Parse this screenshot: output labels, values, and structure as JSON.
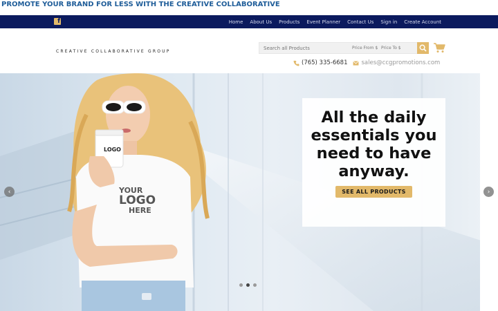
{
  "promo": {
    "text": "PROMOTE YOUR BRAND FOR LESS WITH THE CREATIVE COLLABORATIVE"
  },
  "topnav": {
    "facebook_icon": "facebook-icon",
    "links": [
      "Home",
      "About Us",
      "Products",
      "Event Planner",
      "Contact Us",
      "Sign in",
      "Create Account"
    ]
  },
  "header": {
    "brand": "CREATIVE COLLABORATIVE GROUP",
    "search": {
      "placeholder": "Search all Products",
      "price_from_placeholder": "Price From $",
      "price_to_placeholder": "Price To $"
    },
    "search_icon": "search-icon",
    "cart_icon": "cart-icon",
    "phone": "(765) 335-6681",
    "email": "sales@ccgpromotions.com"
  },
  "hero": {
    "heading": "All the daily essentials you need to have anyway.",
    "cta": "SEE ALL PRODUCTS",
    "cup_logo": "LOGO",
    "shirt_logo_line1": "YOUR",
    "shirt_logo_line2": "LOGO",
    "shirt_logo_line3": "HERE",
    "slides": 3,
    "active_slide": 2
  },
  "colors": {
    "navy": "#0b1a5e",
    "gold": "#e2b96a",
    "promo_blue": "#1f5d99"
  }
}
